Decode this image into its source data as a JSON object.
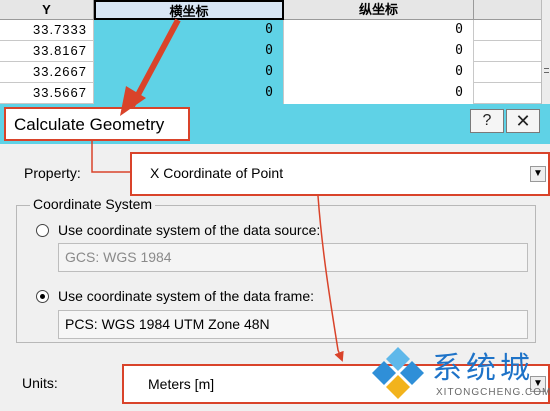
{
  "table": {
    "headers": {
      "col_y": "Y",
      "col_x": "横坐标",
      "col_z": "纵坐标"
    },
    "rows": [
      {
        "y": "33.7333",
        "x": "0",
        "z": "0"
      },
      {
        "y": "33.8167",
        "x": "0",
        "z": "0"
      },
      {
        "y": "33.2667",
        "x": "0",
        "z": "0"
      },
      {
        "y": "33.5667",
        "x": "0",
        "z": "0"
      }
    ],
    "highlight_color": "#5fd2e6"
  },
  "dialog": {
    "title": "Calculate Geometry",
    "help_button": "?",
    "close_button": "✕",
    "property_label": "Property:",
    "property_value": "X Coordinate of Point",
    "coordinate_system_group": "Coordinate System",
    "option_data_source": "Use coordinate system of the data source:",
    "data_source_cs": "GCS: WGS 1984",
    "option_data_frame": "Use coordinate system of the data frame:",
    "data_frame_cs": "PCS: WGS 1984 UTM Zone 48N",
    "selected_option": "data_frame",
    "units_label": "Units:",
    "units_value": "Meters [m]"
  },
  "watermark": {
    "main": "系统城",
    "sub": "XITONGCHENG.COM"
  },
  "colors": {
    "annotation": "#d9432a",
    "accent": "#5fd2e6",
    "watermark": "#1e73c8"
  },
  "icons": {
    "dropdown": "chevron-down-icon",
    "logo": "windows-logo-icon"
  }
}
